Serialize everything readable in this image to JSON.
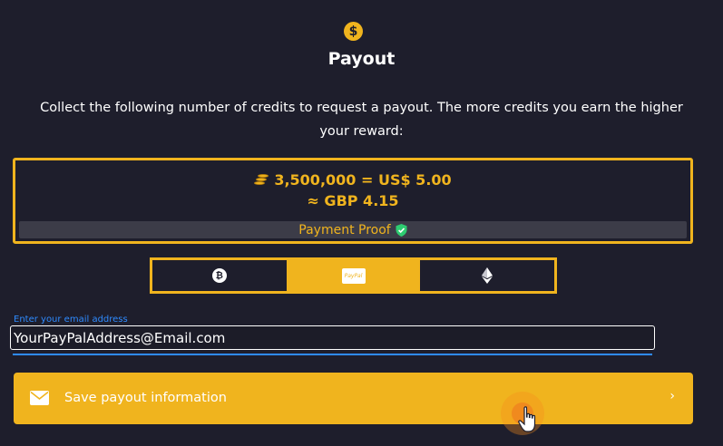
{
  "header": {
    "icon": "dollar-coin-icon",
    "icon_glyph": "$",
    "title": "Payout"
  },
  "description": "Collect the following number of credits to request a payout. The more credits you earn the higher your reward:",
  "reward": {
    "credits_icon": "coins-icon",
    "credits_line": "3,500,000 = US$ 5.00",
    "gbp_line": "≈ GBP 4.15",
    "proof_label": "Payment Proof",
    "proof_icon": "shield-check-icon"
  },
  "payment_methods": {
    "selected": "PayPal",
    "items": [
      {
        "name": "Bitcoin",
        "icon": "bitcoin-icon",
        "glyph": "₿"
      },
      {
        "name": "PayPal",
        "icon": "paypal-icon",
        "glyph": "PayPal"
      },
      {
        "name": "Ethereum",
        "icon": "ethereum-icon"
      }
    ]
  },
  "email": {
    "label": "Enter your email address",
    "value": "YourPayPalAddress@Email.com"
  },
  "save": {
    "icon": "mail-icon",
    "label": "Save payout information",
    "chevron": "›"
  },
  "colors": {
    "background": "#1e1e2c",
    "accent": "#f0b41e",
    "input_label": "#2f8bff",
    "proof_bar": "#3c3c48",
    "shield": "#2ecc71"
  }
}
